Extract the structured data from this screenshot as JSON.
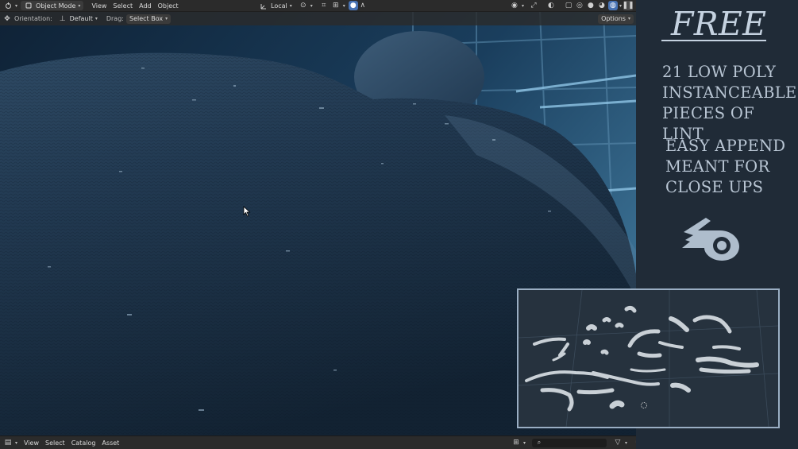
{
  "topbar": {
    "mode_label": "Object Mode",
    "menus": [
      "View",
      "Select",
      "Add",
      "Object"
    ],
    "transform_label": "Local"
  },
  "toolbar2": {
    "orientation_label": "Orientation:",
    "orientation_value": "Default",
    "drag_label": "Drag:",
    "drag_value": "Select Box",
    "options_label": "Options"
  },
  "bottombar": {
    "menus": [
      "View",
      "Select",
      "Catalog",
      "Asset"
    ]
  },
  "promo": {
    "free": "FREE",
    "lines1": [
      "21 LOW POLY",
      "INSTANCEABLE",
      "PIECES OF LINT"
    ],
    "lines2": [
      "EASY APPEND",
      "MEANT FOR",
      "CLOSE UPS"
    ]
  },
  "icons": {
    "editor_type": "3d-viewport-icon",
    "logo": "blender-logo-icon"
  },
  "colors": {
    "header_bg": "#2b2b2b",
    "accent": "#4772b3",
    "promo_bg": "#202b37",
    "promo_text": "#b9c6d4"
  }
}
